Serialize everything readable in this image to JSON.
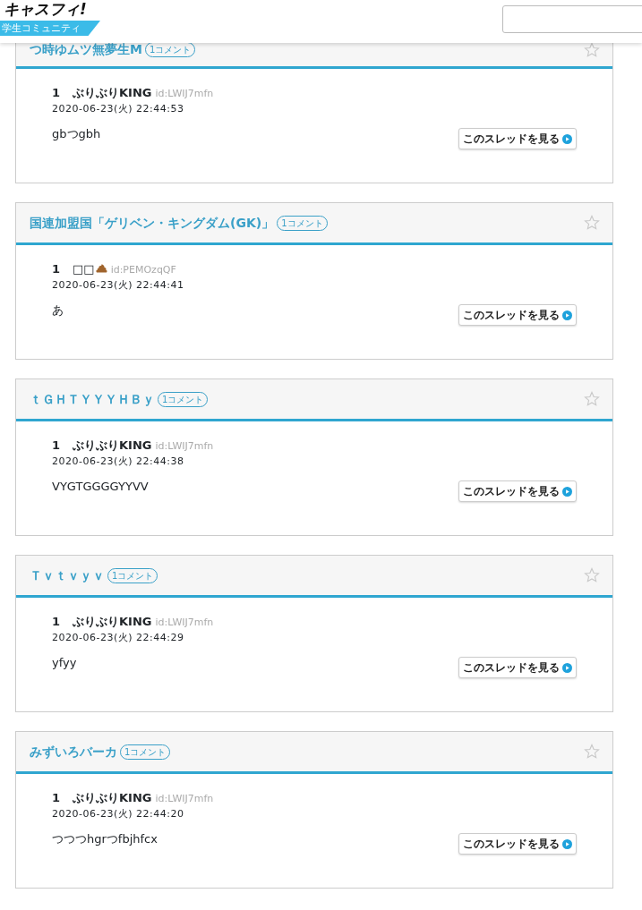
{
  "header": {
    "logo": "キャスフィ!",
    "tagline": "学生コミュニティ"
  },
  "threads": [
    {
      "title": "つ時ゆムツ無夢生M",
      "comments": "1コメント",
      "favorite": false,
      "post": {
        "number": "1",
        "author": "ぶりぶりKING",
        "author_icon": false,
        "id": "id:LWIJ7mfn",
        "date": "2020-06-23(火) 22:44:53",
        "body": "gbつgbh"
      },
      "button": "このスレッドを見る"
    },
    {
      "title": "国連加盟国「ゲリベン・キングダム(GK)」",
      "comments": "1コメント",
      "favorite": false,
      "post": {
        "number": "1",
        "author": "□□",
        "author_icon": true,
        "id": "id:PEMOzqQF",
        "date": "2020-06-23(火) 22:44:41",
        "body": "あ"
      },
      "button": "このスレッドを見る"
    },
    {
      "title": "ｔＧＨＴＹＹＹＨＢｙ",
      "comments": "1コメント",
      "favorite": false,
      "post": {
        "number": "1",
        "author": "ぶりぶりKING",
        "author_icon": false,
        "id": "id:LWIJ7mfn",
        "date": "2020-06-23(火) 22:44:38",
        "body": "VYGTGGGGYYVV"
      },
      "button": "このスレッドを見る"
    },
    {
      "title": "Ｔｖｔｖｙｖ",
      "comments": "1コメント",
      "favorite": false,
      "post": {
        "number": "1",
        "author": "ぶりぶりKING",
        "author_icon": false,
        "id": "id:LWIJ7mfn",
        "date": "2020-06-23(火) 22:44:29",
        "body": "yfyy"
      },
      "button": "このスレッドを見る"
    },
    {
      "title": "みずいろバーカ",
      "comments": "1コメント",
      "favorite": false,
      "post": {
        "number": "1",
        "author": "ぶりぶりKING",
        "author_icon": false,
        "id": "id:LWIJ7mfn",
        "date": "2020-06-23(火) 22:44:20",
        "body": "つつつhgrつfbjhfcx"
      },
      "button": "このスレッドを見る"
    }
  ]
}
